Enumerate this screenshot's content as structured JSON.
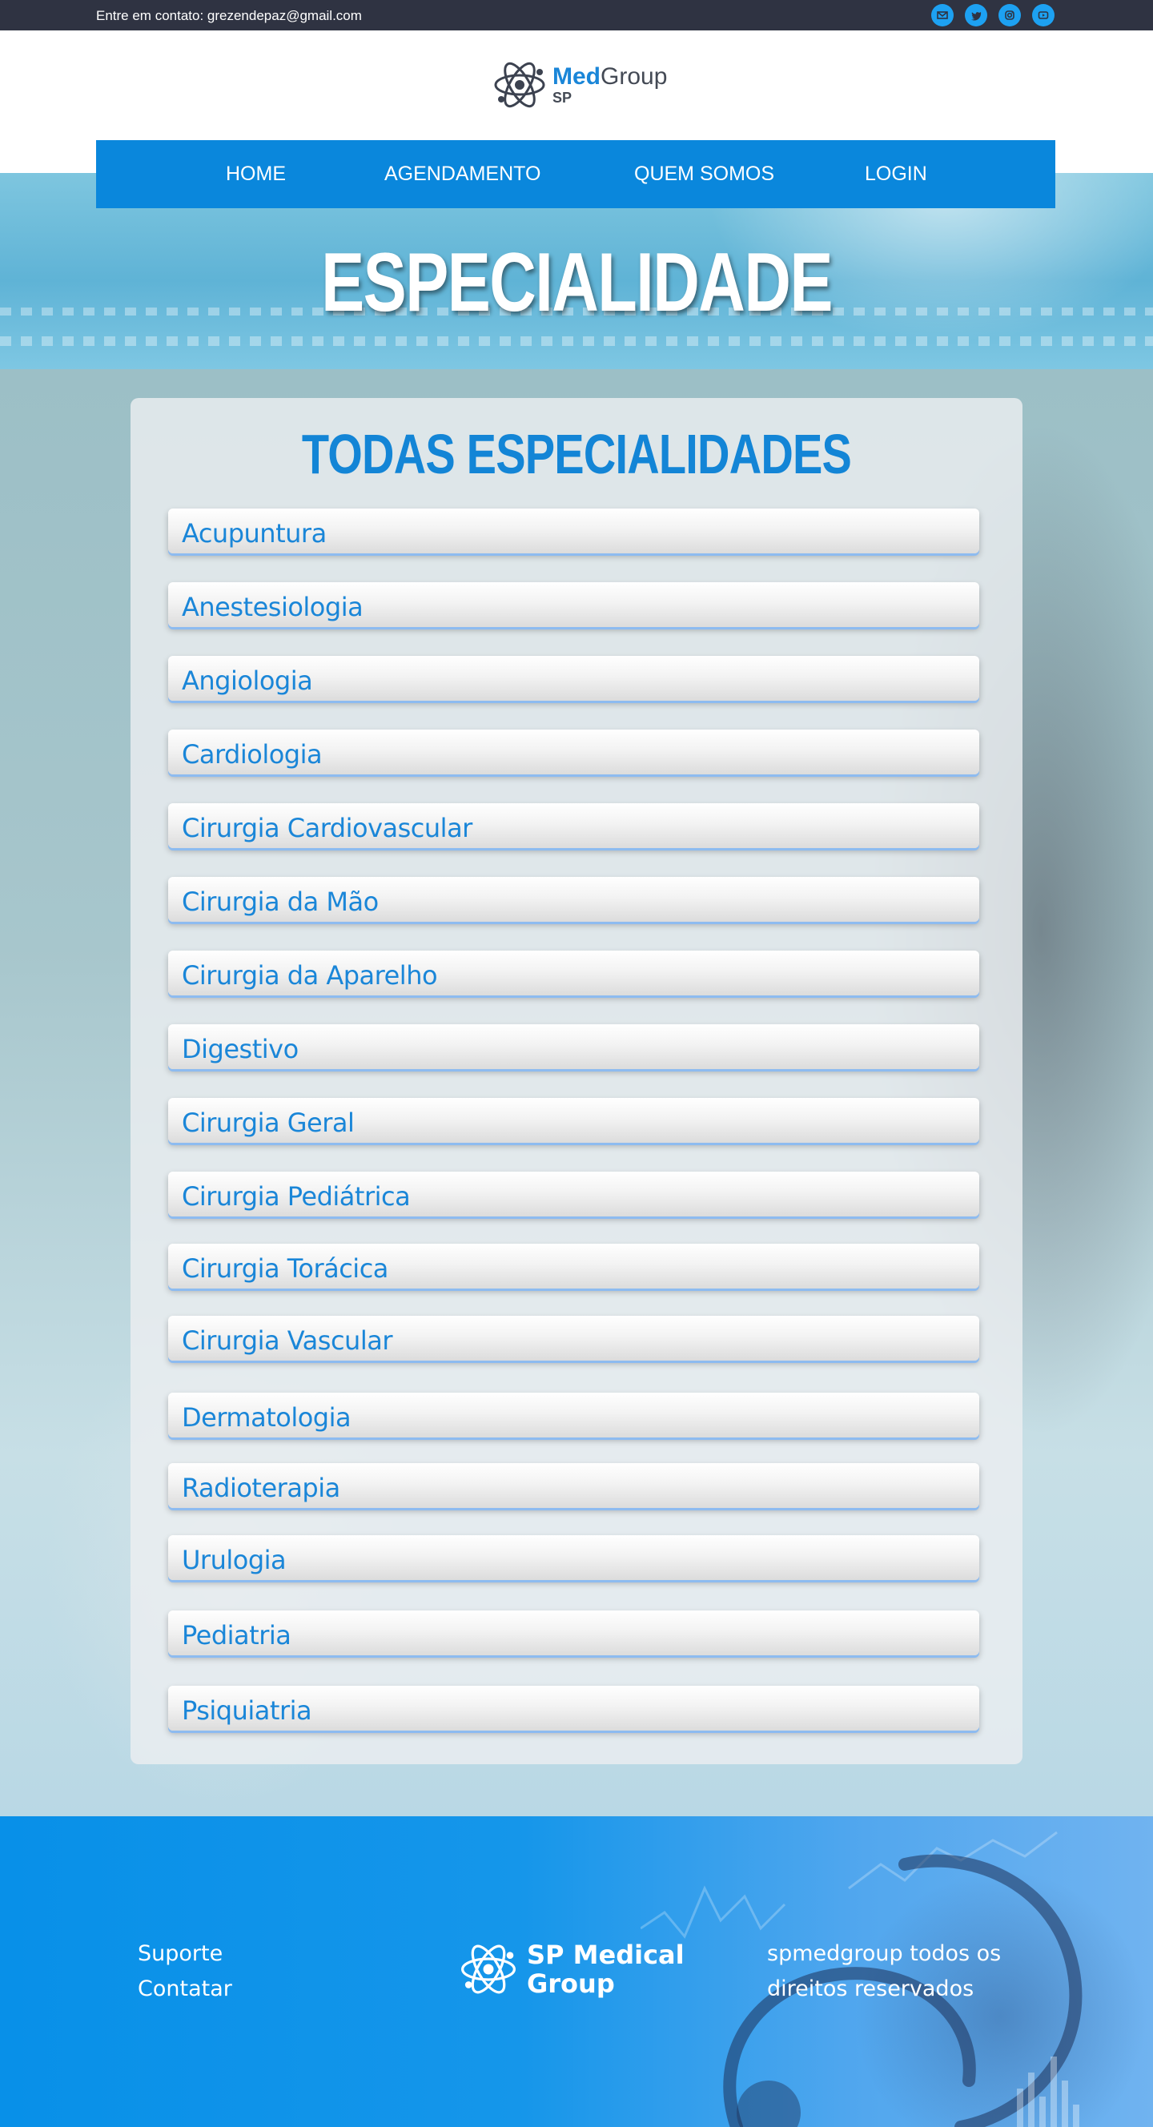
{
  "topbar": {
    "contact": "Entre em contato: grezendepaz@gmail.com",
    "social_icons": [
      "email-icon",
      "twitter-icon",
      "instagram-icon",
      "youtube-icon"
    ]
  },
  "logo": {
    "med": "Med",
    "group": "Group",
    "sp": "SP"
  },
  "nav": {
    "items": [
      {
        "label": "HOME"
      },
      {
        "label": "AGENDAMENTO"
      },
      {
        "label": "QUEM SOMOS"
      },
      {
        "label": "LOGIN"
      }
    ]
  },
  "hero": {
    "title": "ESPECIALIDADE"
  },
  "specialties": {
    "title": "TODAS ESPECIALIDADES",
    "items": [
      "Acupuntura",
      "Anestesiologia",
      "Angiologia",
      "Cardiologia",
      "Cirurgia Cardiovascular",
      "Cirurgia da Mão",
      "Cirurgia da Aparelho",
      "Digestivo",
      "Cirurgia Geral",
      "Cirurgia Pediátrica",
      "Cirurgia Torácica",
      "Cirurgia Vascular",
      "Dermatologia",
      "Radioterapia",
      "Urulogia",
      "Pediatria",
      "Psiquiatria"
    ]
  },
  "footer": {
    "links": [
      "Suporte",
      "Contatar"
    ],
    "brand": "SP Medical Group",
    "copyright": "spmedgroup todos os direitos reservados"
  },
  "colors": {
    "primary": "#0a87dc",
    "topbar": "#2f3342",
    "accent_text": "#1a86d8"
  }
}
